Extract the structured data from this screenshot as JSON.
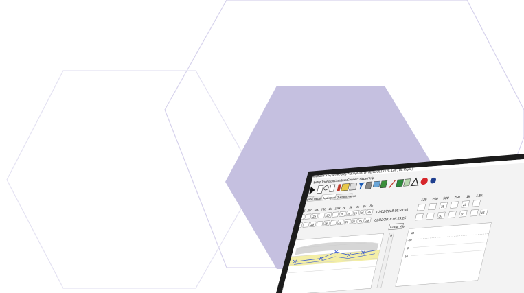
{
  "app": {
    "title": "Audbase 5.5 | MYR76 by Ha ingham on 02/02/2018 | BL Left | BL Right |",
    "menu": [
      "File",
      "Setup",
      "Tool",
      "Edit",
      "Database",
      "Connect to",
      "Type",
      "Help"
    ],
    "tabs": [
      "Register",
      "Details",
      "Audiograms",
      "Questionnaires"
    ],
    "active_tab": "Audiograms"
  },
  "left_panel": {
    "freq_headers": [
      "125",
      "250",
      "500",
      "750",
      "1k",
      "1.5k",
      "2k",
      "3k",
      "4k",
      "6k",
      "8k"
    ],
    "row1_values": [
      "",
      "",
      "25",
      "",
      "25",
      "",
      "25",
      "25",
      "25",
      "25",
      "45"
    ],
    "row2_values": [
      "",
      "",
      "25",
      "",
      "25",
      "",
      "25",
      "25",
      "25",
      "25",
      "35"
    ],
    "date1": "02/02/2018 05:59:55",
    "date2": "02/02/2018 05:29:25",
    "colour_key_label": "Colour Key",
    "chart_axis_unit": "dB"
  },
  "right_panel": {
    "freq_headers": [
      "125",
      "250",
      "500",
      "750",
      "1k",
      "1.5k"
    ],
    "row1_values": [
      "",
      "",
      "35",
      "",
      "25",
      ""
    ],
    "row2_values": [
      "",
      "",
      "30",
      "",
      "20",
      "",
      "15"
    ],
    "chart_axis_unit": "dB",
    "y_ticks": [
      "-10",
      "0",
      "10"
    ]
  },
  "colors": {
    "hexagon_fill": "#c5c0e0",
    "hexagon_stroke": "#d4d0ec",
    "series": "#3a5bd0",
    "band": "#f3eea6"
  }
}
